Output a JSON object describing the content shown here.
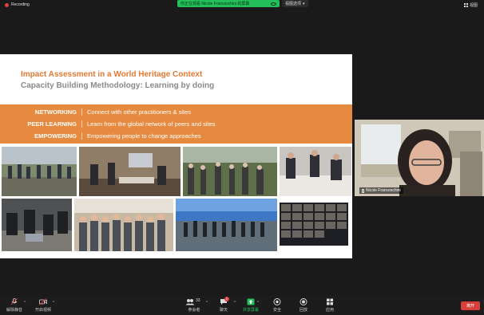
{
  "topbar": {
    "recording_label": "Recording",
    "share_banner": "你正在观看 Nicole Franceschini 的屏幕",
    "view_options": "视图选项",
    "view_label": "视图"
  },
  "slide": {
    "title": "Impact Assessment in a World Heritage Context",
    "subtitle": "Capacity Building Methodology: Learning by doing",
    "rows": [
      {
        "key": "NETWORKING",
        "desc": "Connect with other practitioners & sites"
      },
      {
        "key": "PEER LEARNING",
        "desc": "Learn from the global network of peers and sites"
      },
      {
        "key": "EMPOWERING",
        "desc": "Empowering people to change approaches"
      }
    ],
    "title_color": "#e07a33",
    "band_color": "#e58a3f"
  },
  "participant": {
    "name": "Nicole Franceschini"
  },
  "toolbar": {
    "mute_label": "解除静音",
    "video_label": "开启视频",
    "participants_label": "参会者",
    "participants_count": "33",
    "chat_label": "聊天",
    "chat_badge": "2",
    "share_label": "共享屏幕",
    "security_label": "安全",
    "record_label": "回放",
    "apps_label": "应用",
    "leave_label": "离开"
  }
}
